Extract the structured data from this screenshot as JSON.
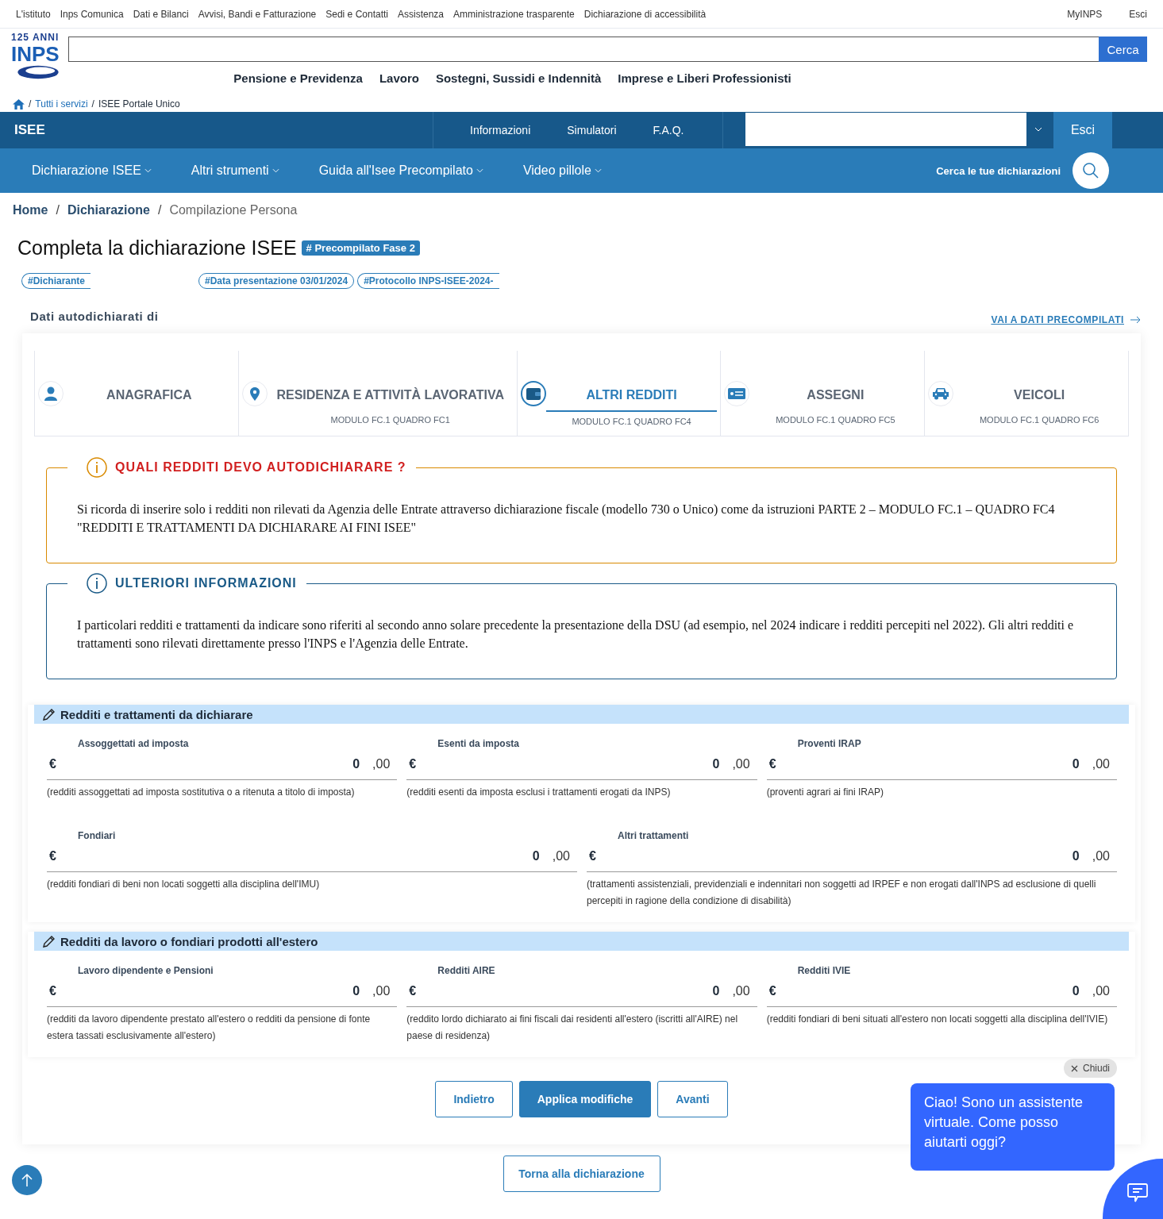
{
  "top_links": [
    "L'istituto",
    "Inps Comunica",
    "Dati e Bilanci",
    "Avvisi, Bandi e Fatturazione",
    "Sedi e Contatti",
    "Assistenza",
    "Amministrazione trasparente",
    "Dichiarazione di accessibilità"
  ],
  "top_right": [
    "MyINPS",
    "Esci"
  ],
  "logo": {
    "badge": "125 ANNI",
    "name": "INPS"
  },
  "search_button": "Cerca",
  "main_nav": [
    "Pensione e Previdenza",
    "Lavoro",
    "Sostegni, Sussidi e Indennità",
    "Imprese e Liberi Professionisti"
  ],
  "site_breadcrumb": [
    {
      "sep": "/",
      "label": "Tutti i servizi",
      "link": true
    },
    {
      "sep": "/",
      "label": "ISEE Portale Unico",
      "link": false
    }
  ],
  "isee_bar": {
    "logo": "ISEE",
    "links": [
      "Informazioni",
      "Simulatori",
      "F.A.Q."
    ],
    "logout": "Esci"
  },
  "isee_nav": [
    "Dichiarazione ISEE",
    "Altri strumenti",
    "Guida all'Isee Precompilato",
    "Video pillole"
  ],
  "search_declarations": "Cerca le tue dichiarazioni",
  "breadcrumb": [
    {
      "label": "Home",
      "link": true
    },
    {
      "sep": "/",
      "label": "Dichiarazione",
      "link": true
    },
    {
      "sep": "/",
      "label": "Compilazione Persona",
      "link": false
    }
  ],
  "title": "Completa la dichiarazione ISEE",
  "title_badge": "# Precompilato Fase 2",
  "tags": [
    "#Dichiarante",
    "#Data presentazione 03/01/2024",
    "#Protocollo INPS-ISEE-2024-"
  ],
  "subtitle": "Dati autodichiarati di",
  "precompiled_link": "VAI A DATI PRECOMPILATI",
  "steps": [
    {
      "label": "ANAGRAFICA",
      "selected": false
    },
    {
      "label": "RESIDENZA E ATTIVITÀ LAVORATIVA",
      "sub": "MODULO FC.1 QUADRO FC1",
      "selected": false
    },
    {
      "label": "ALTRI REDDITI",
      "sub": "MODULO FC.1 QUADRO FC4",
      "selected": true
    },
    {
      "label": "ASSEGNI",
      "sub": "MODULO FC.1 QUADRO FC5",
      "selected": false
    },
    {
      "label": "VEICOLI",
      "sub": "MODULO FC.1 QUADRO FC6",
      "selected": false
    }
  ],
  "notices": [
    {
      "kind": "warning",
      "title": "QUALI REDDITI DEVO AUTODICHIARARE ?",
      "text": "Si ricorda di inserire solo i redditi non rilevati da Agenzia delle Entrate attraverso dichiarazione fiscale (modello 730 o Unico) come da istruzioni PARTE 2 – MODULO FC.1 – QUADRO FC4 \"REDDITI E TRATTAMENTI DA DICHIARARE AI FINI ISEE\""
    },
    {
      "kind": "info",
      "title": "ULTERIORI INFORMAZIONI",
      "text": "I particolari redditi e trattamenti da indicare sono riferiti al secondo anno solare precedente la presentazione della DSU (ad esempio, nel 2024 indicare i redditi percepiti nel 2022). Gli altri redditi e trattamenti sono rilevati direttamente presso l'INPS e l'Agenzia delle Entrate."
    }
  ],
  "sections": [
    {
      "title": "Redditi e trattamenti da dichiarare",
      "rows": [
        [
          {
            "label": "Assoggettati ad imposta",
            "currency": "€",
            "value": "0",
            "decimals": ",00",
            "hint": "(redditi assoggettati ad imposta sostitutiva o a ritenuta a titolo di imposta)"
          },
          {
            "label": "Esenti da imposta",
            "currency": "€",
            "value": "0",
            "decimals": ",00",
            "hint": "(redditi esenti da imposta esclusi i trattamenti erogati da INPS)"
          },
          {
            "label": "Proventi IRAP",
            "currency": "€",
            "value": "0",
            "decimals": ",00",
            "hint": "(proventi agrari ai fini IRAP)"
          }
        ],
        [
          {
            "label": "Fondiari",
            "currency": "€",
            "value": "0",
            "decimals": ",00",
            "hint": "(redditi fondiari di beni non locati soggetti alla disciplina dell'IMU)"
          },
          {
            "label": "Altri trattamenti",
            "currency": "€",
            "value": "0",
            "decimals": ",00",
            "hint": "(trattamenti assistenziali, previdenziali e indennitari non soggetti ad IRPEF e non erogati dall'INPS ad esclusione di quelli percepiti in ragione della condizione di disabilità)"
          }
        ]
      ]
    },
    {
      "title": "Redditi da lavoro o fondiari prodotti all'estero",
      "rows": [
        [
          {
            "label": "Lavoro dipendente e Pensioni",
            "currency": "€",
            "value": "0",
            "decimals": ",00",
            "hint": "(redditi da lavoro dipendente prestato all'estero o redditi da pensione di fonte estera tassati esclusivamente all'estero)"
          },
          {
            "label": "Redditi AIRE",
            "currency": "€",
            "value": "0",
            "decimals": ",00",
            "hint": "(reddito lordo dichiarato ai fini fiscali dai residenti all'estero (iscritti all'AIRE) nel paese di residenza)"
          },
          {
            "label": "Redditi IVIE",
            "currency": "€",
            "value": "0",
            "decimals": ",00",
            "hint": "(redditi fondiari di beni situati all'estero non locati soggetti alla disciplina dell'IVIE)"
          }
        ]
      ]
    }
  ],
  "actions": [
    {
      "label": "Indietro",
      "primary": false
    },
    {
      "label": "Applica modifiche",
      "primary": true
    },
    {
      "label": "Avanti",
      "primary": false
    }
  ],
  "back_button": "Torna alla dichiarazione",
  "chat": {
    "close": "Chiudi",
    "message": "Ciao! Sono un assistente virtuale. Come posso aiutarti oggi?"
  }
}
